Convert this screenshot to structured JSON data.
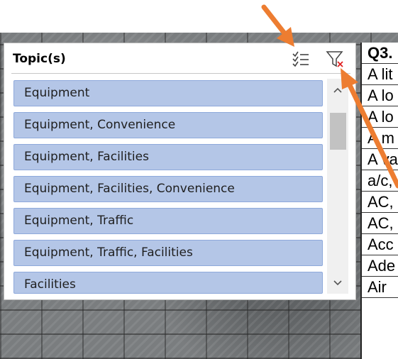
{
  "slicer": {
    "title": "Topic(s)",
    "items": [
      {
        "label": "Equipment"
      },
      {
        "label": "Equipment, Convenience"
      },
      {
        "label": "Equipment, Facilities"
      },
      {
        "label": "Equipment, Facilities, Convenience"
      },
      {
        "label": "Equipment, Traffic"
      },
      {
        "label": "Equipment, Traffic, Facilities"
      },
      {
        "label": "Facilities"
      }
    ],
    "multi_select_icon": "multi-select-icon",
    "clear_filter_icon": "clear-filter-icon"
  },
  "grid": {
    "header": "Q3.",
    "cells": [
      "A lit",
      "A lo",
      "A lo",
      "A m",
      "A va",
      "a/c,",
      "AC,",
      "AC,",
      "Acc",
      "Ade",
      "Air"
    ]
  },
  "colors": {
    "item_fill": "#b4c6e7",
    "item_border": "#8ea9db",
    "annotation_arrow": "#ed7d31"
  }
}
